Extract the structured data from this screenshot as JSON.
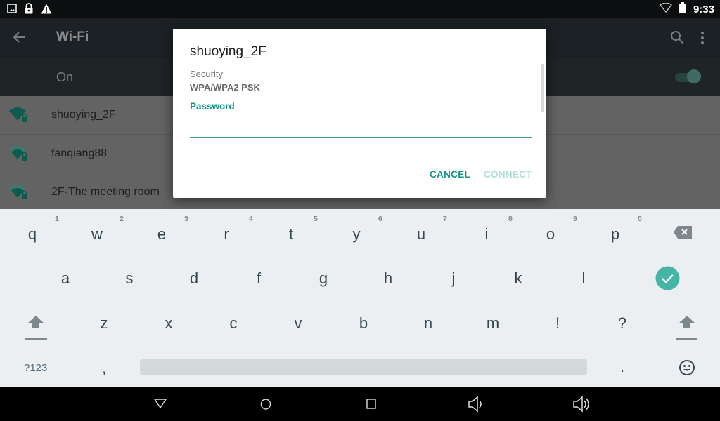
{
  "status_bar": {
    "left_icons": [
      "image-icon",
      "lock-icon",
      "warning-icon"
    ],
    "right_icons": [
      "wifi-signal-icon",
      "battery-icon"
    ],
    "time": "9:33"
  },
  "app_bar": {
    "title": "Wi-Fi",
    "back_icon": "arrow-left-icon",
    "actions": [
      "search-icon",
      "more-vert-icon"
    ]
  },
  "wifi_toggle": {
    "label": "On",
    "state": true,
    "accent_color": "#3f6b62"
  },
  "networks": [
    {
      "name": "shuoying_2F",
      "signal": "full",
      "secured": true
    },
    {
      "name": "fanqiang88",
      "signal": "medium",
      "secured": true
    },
    {
      "name": "2F-The meeting room",
      "signal": "medium",
      "secured": true
    }
  ],
  "dialog": {
    "title": "shuoying_2F",
    "security_label": "Security",
    "security_value": "WPA/WPA2 PSK",
    "password_label": "Password",
    "password_value": "",
    "cancel_label": "CANCEL",
    "connect_label": "CONNECT",
    "connect_enabled": false,
    "accent_color": "#139587"
  },
  "keyboard": {
    "row1": [
      {
        "key": "q",
        "hint": "1"
      },
      {
        "key": "w",
        "hint": "2"
      },
      {
        "key": "e",
        "hint": "3"
      },
      {
        "key": "r",
        "hint": "4"
      },
      {
        "key": "t",
        "hint": "5"
      },
      {
        "key": "y",
        "hint": "6"
      },
      {
        "key": "u",
        "hint": "7"
      },
      {
        "key": "i",
        "hint": "8"
      },
      {
        "key": "o",
        "hint": "9"
      },
      {
        "key": "p",
        "hint": "0"
      }
    ],
    "row2": [
      "a",
      "s",
      "d",
      "f",
      "g",
      "h",
      "j",
      "k",
      "l"
    ],
    "row3": [
      "z",
      "x",
      "c",
      "v",
      "b",
      "n",
      "m",
      "!",
      "?"
    ],
    "symbols_label": "?123",
    "comma": ",",
    "period": ".",
    "icons": [
      "backspace-icon",
      "done-check-icon",
      "shift-icon",
      "emoji-icon"
    ]
  },
  "nav_bar": {
    "icons": [
      "back-triangle-icon",
      "home-circle-icon",
      "recents-square-icon",
      "volume-down-icon",
      "volume-up-icon"
    ]
  }
}
